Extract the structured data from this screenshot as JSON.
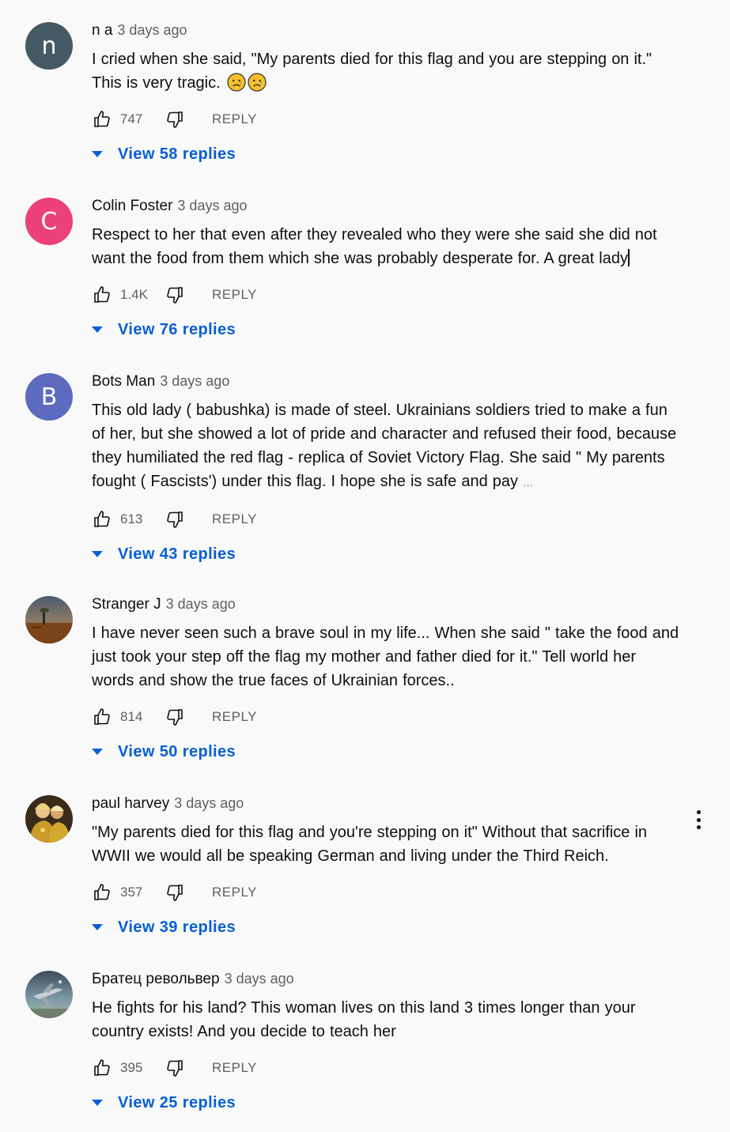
{
  "colors": {
    "background": "#f9f9f9",
    "link_blue": "#065fd4",
    "meta_gray": "#606060"
  },
  "comments": [
    {
      "author": "n a",
      "time": "3 days ago",
      "avatar_letter": "n",
      "avatar_color": "#455a64",
      "text": "I cried when she said, \"My parents died for this flag and you are stepping on it.\" This is very tragic.",
      "emojis": [
        "sad-face-emoji",
        "sad-face-emoji"
      ],
      "likes": "747",
      "reply_label": "REPLY",
      "replies_label": "View 58 replies"
    },
    {
      "author": "Colin Foster",
      "time": "3 days ago",
      "avatar_letter": "C",
      "avatar_color": "#ec407a",
      "text": "Respect to her that even after they revealed who they were she said she did not want the food from them which she was probably desperate for.  A great lady",
      "likes": "1.4K",
      "reply_label": "REPLY",
      "replies_label": "View 76 replies"
    },
    {
      "author": "Bots Man",
      "time": "3 days ago",
      "avatar_letter": "B",
      "avatar_color": "#5c6bc0",
      "text": "This old lady ( babushka)  is made of steel. Ukrainians soldiers tried to make a fun of her, but she showed a lot of pride and character and refused their food, because they humiliated the red flag - replica of Soviet Victory Flag. She said \" My parents fought ( Fascists') under this flag. I hope she is safe and pay",
      "more": "…",
      "likes": "613",
      "reply_label": "REPLY",
      "replies_label": "View 43 replies"
    },
    {
      "author": "Stranger J",
      "time": "3 days ago",
      "avatar_image": "landscape-photo",
      "text": "I have never seen such a brave soul in my life...  When she said \" take the food and just took your step off the flag my mother and father died for it.\"  Tell world her words and show the true faces of Ukrainian forces..",
      "likes": "814",
      "reply_label": "REPLY",
      "replies_label": "View 50 replies"
    },
    {
      "author": "paul harvey",
      "time": "3 days ago",
      "avatar_image": "people-photo",
      "text": "\"My parents died for this flag and you're stepping on it\" Without that sacrifice in WWII we would all be speaking German and living under the Third Reich.",
      "likes": "357",
      "reply_label": "REPLY",
      "replies_label": "View 39 replies",
      "menu_icon": "more-vertical-icon"
    },
    {
      "author": "Братец револьвер",
      "time": "3 days ago",
      "avatar_image": "aircraft-photo",
      "text": "He fights for his land? This woman lives on this land 3 times longer than your country exists! And you decide to teach her",
      "likes": "395",
      "reply_label": "REPLY",
      "replies_label": "View 25 replies"
    }
  ]
}
